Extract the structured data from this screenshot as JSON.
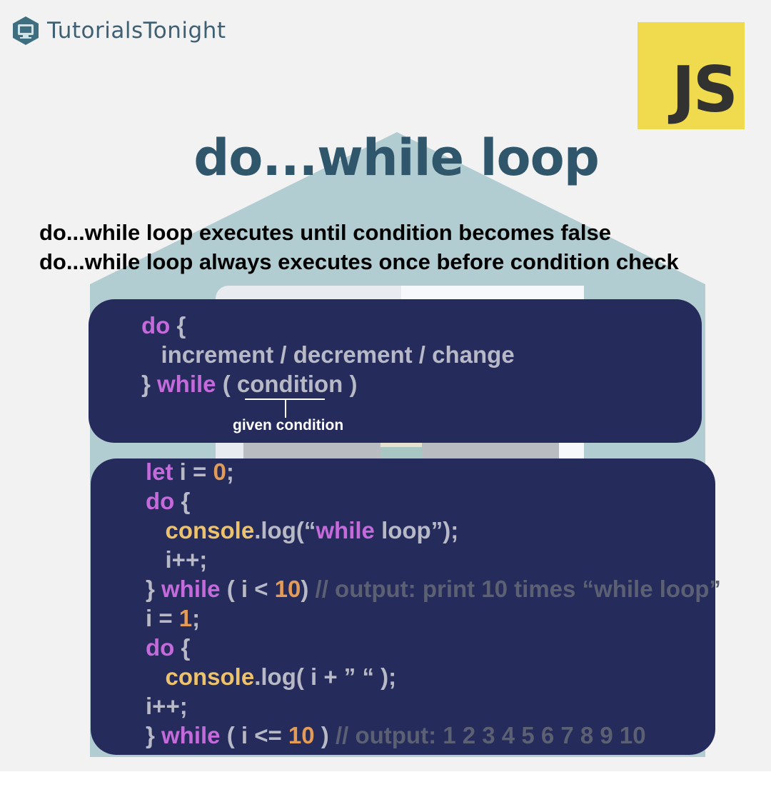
{
  "brand": {
    "name": "TutorialsTonight",
    "badge": "JS"
  },
  "title": "do...while loop",
  "descriptions": [
    "do...while loop executes until condition becomes false",
    "do...while loop always executes once before condition check"
  ],
  "syntax_block": {
    "line1": {
      "kw": "do",
      "rest": " {"
    },
    "line2": "   increment / decrement / change",
    "line3": {
      "brace": "} ",
      "kw": "while",
      "open": " ( ",
      "cond": "condition",
      "close": " )"
    },
    "annotation": "given condition"
  },
  "example_block": {
    "l1": {
      "kw": "let",
      "a": " i = ",
      "num": "0",
      "b": ";"
    },
    "l2": {
      "kw": "do",
      "a": " {"
    },
    "l3": {
      "fn": "   console",
      "a": ".log(“",
      "kw": "while",
      "b": " loop”);"
    },
    "l4": "   i++;",
    "l5": {
      "a": "} ",
      "kw": "while",
      "b": " ( i < ",
      "num": "10",
      "c": ") ",
      "comment": "// output: print 10 times “while loop”"
    },
    "l6": {
      "a": "i = ",
      "num": "1",
      "b": ";"
    },
    "l7": {
      "kw": "do",
      "a": " {"
    },
    "l8": {
      "fn": "   console",
      "a": ".log( i + ” “ );"
    },
    "l9": "i++;",
    "l10": {
      "a": "} ",
      "kw": "while",
      "b": " ( i <= ",
      "num": "10",
      "c": " ) ",
      "comment": "// output: 1 2 3 4 5 6 7 8 9 10"
    }
  },
  "colors": {
    "background": "#f2f2f2",
    "panel": "#252b5a",
    "keyword": "#c46adb",
    "function": "#ecc26d",
    "number": "#e39b58",
    "comment": "#5b6073",
    "plain_code": "#b8b9c6",
    "title": "#2f566b",
    "js_badge": "#f0db4f"
  }
}
